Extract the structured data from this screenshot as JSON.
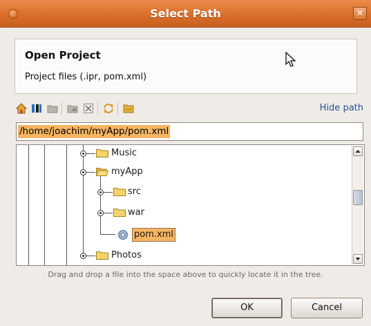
{
  "window": {
    "title": "Select Path",
    "close_glyph": "✕",
    "accent": "#d96f2a"
  },
  "header": {
    "title": "Open Project",
    "subtitle": "Project files (.ipr, pom.xml)"
  },
  "toolbar": {
    "icons": [
      "home-icon",
      "intellij-project-icon",
      "new-folder-icon",
      "delete-folder-icon",
      "delete-icon",
      "refresh-icon",
      "show-hidden-icon"
    ],
    "hide_path_label": "Hide path"
  },
  "path": {
    "value": "/home/joachim/myApp/pom.xml"
  },
  "tree": {
    "items": [
      {
        "label": "Music",
        "type": "folder",
        "depth": 0,
        "expanded": false
      },
      {
        "label": "myApp",
        "type": "folder",
        "depth": 0,
        "expanded": true
      },
      {
        "label": "src",
        "type": "folder",
        "depth": 1,
        "expanded": false
      },
      {
        "label": "war",
        "type": "folder",
        "depth": 1,
        "expanded": false
      },
      {
        "label": "pom.xml",
        "type": "file",
        "depth": 1,
        "selected": true
      },
      {
        "label": "Photos",
        "type": "folder",
        "depth": 0,
        "expanded": false
      }
    ]
  },
  "hint": "Drag and drop a file into the space above to quickly locate it in the tree.",
  "buttons": {
    "ok": "OK",
    "cancel": "Cancel"
  },
  "colors": {
    "selection": "#f7b462",
    "title_bar": "#d96f2a"
  }
}
